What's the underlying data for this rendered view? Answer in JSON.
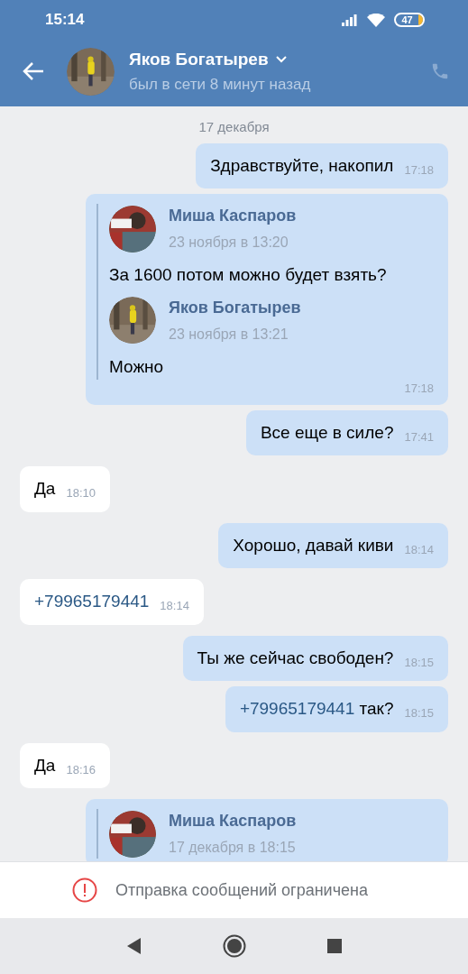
{
  "status_bar": {
    "time": "15:14",
    "battery": "47"
  },
  "header": {
    "name": "Яков Богатырев",
    "status": "был в сети 8 минут назад"
  },
  "messages": [
    {
      "kind": "date",
      "text": "17 декабря"
    },
    {
      "kind": "outgoing",
      "text": "Здравствуйте, накопил",
      "time": "17:18"
    },
    {
      "kind": "outgoing_forward",
      "time": "17:18",
      "quotes": [
        {
          "author": "Миша Каспаров",
          "date": "23 ноября в 13:20",
          "text": "За 1600 потом можно будет взять?"
        },
        {
          "author": "Яков Богатырев",
          "date": "23 ноября в 13:21",
          "text": "Можно"
        }
      ]
    },
    {
      "kind": "outgoing",
      "text": "Все еще в силе?",
      "time": "17:41"
    },
    {
      "kind": "incoming",
      "text": "Да",
      "time": "18:10"
    },
    {
      "kind": "outgoing",
      "text": "Хорошо, давай киви",
      "time": "18:14"
    },
    {
      "kind": "incoming",
      "link": "+79965179441",
      "time": "18:14"
    },
    {
      "kind": "outgoing",
      "text": "Ты же сейчас свободен?",
      "time": "18:15"
    },
    {
      "kind": "outgoing",
      "link": "+79965179441",
      "text": "так?",
      "time": "18:15"
    },
    {
      "kind": "incoming",
      "text": "Да",
      "time": "18:16"
    },
    {
      "kind": "outgoing_forward",
      "quotes": [
        {
          "author": "Миша Каспаров",
          "date": "17 декабря в 18:15"
        }
      ]
    }
  ],
  "notice": "Отправка сообщений ограничена"
}
